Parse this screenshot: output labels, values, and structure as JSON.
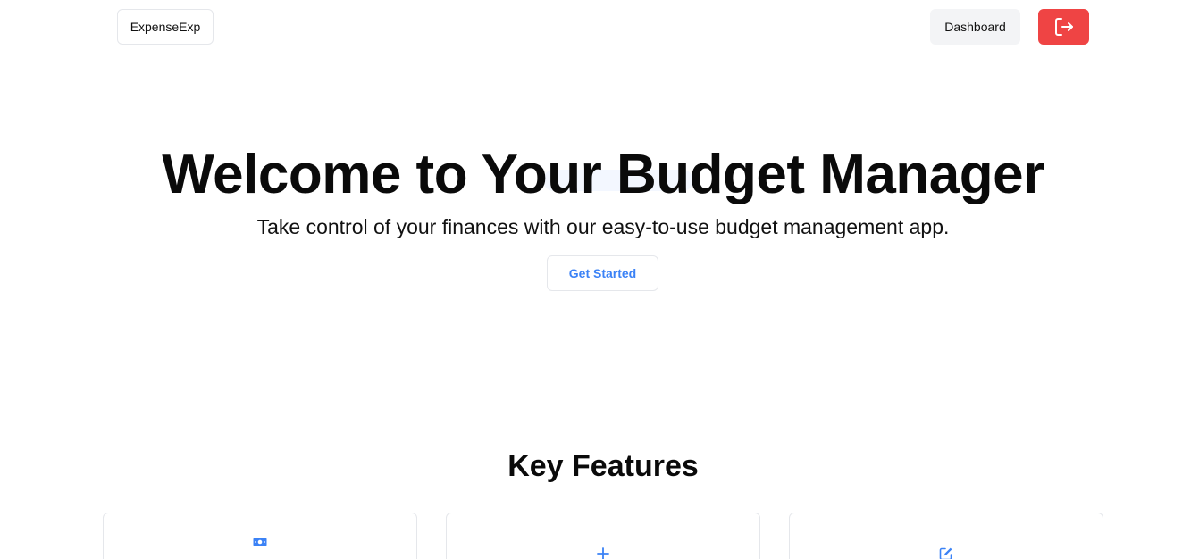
{
  "navbar": {
    "brand": "ExpenseExp",
    "dashboard_label": "Dashboard",
    "logout_icon": "logout-icon",
    "logout_color": "#ef4444"
  },
  "hero": {
    "title": "Welcome to Your Budget Manager",
    "subtitle": "Take control of your finances with our easy-to-use budget management app.",
    "cta_label": "Get Started",
    "accent": "#3b82f6"
  },
  "features": {
    "title": "Key Features",
    "cards": [
      {
        "icon": "money-bill-icon"
      },
      {
        "icon": "plus-icon"
      },
      {
        "icon": "edit-icon"
      }
    ]
  }
}
